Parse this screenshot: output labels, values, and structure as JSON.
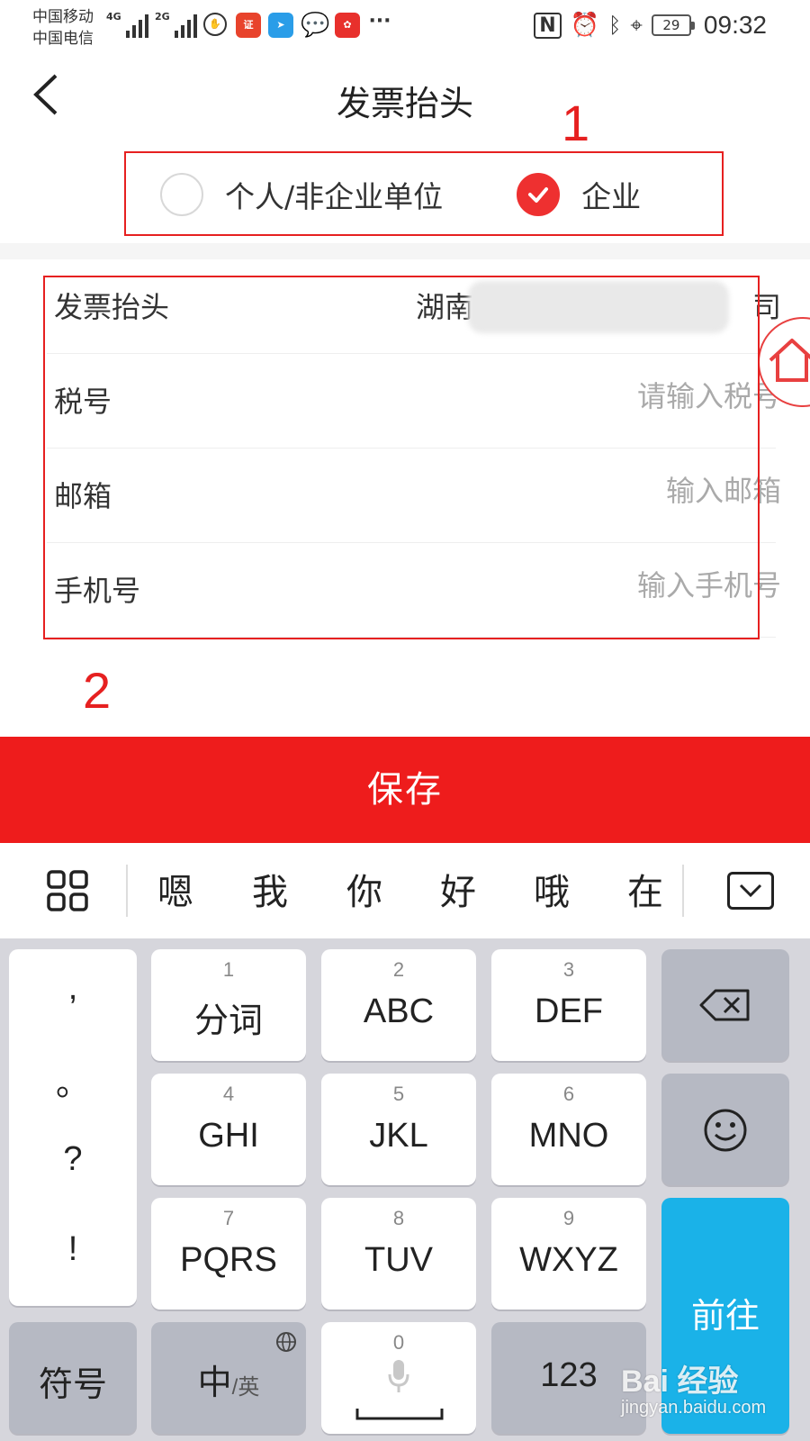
{
  "status_bar": {
    "carrier1": "中国移动",
    "carrier2": "中国电信",
    "net1": "4G",
    "net2": "2G",
    "battery": "29",
    "time": "09:32",
    "more": "···"
  },
  "nav": {
    "back_icon": "chevron-left-icon",
    "title": "发票抬头"
  },
  "annotations": {
    "num1": "1",
    "num2": "2",
    "color": "#e62020"
  },
  "invoice_type": {
    "options": [
      {
        "label": "个人/非企业单位",
        "checked": false
      },
      {
        "label": "企业",
        "checked": true
      }
    ],
    "check_color": "#ee3030"
  },
  "form": {
    "title_row": {
      "label": "发票抬头",
      "value_start": "湖南-",
      "value_end": "司"
    },
    "tax_row": {
      "label": "税号",
      "placeholder": "请输入税号"
    },
    "email_row": {
      "label": "邮箱",
      "placeholder": "输入邮箱"
    },
    "phone_row": {
      "label": "手机号",
      "placeholder": "输入手机号"
    }
  },
  "save_button": {
    "label": "保存",
    "color": "#ee1c1c"
  },
  "candidates": [
    "嗯",
    "我",
    "你",
    "好",
    "哦",
    "在"
  ],
  "keyboard": {
    "punct": [
      ",",
      "。",
      "?",
      "!"
    ],
    "keys": [
      {
        "num": "1",
        "label": "分词"
      },
      {
        "num": "2",
        "label": "ABC"
      },
      {
        "num": "3",
        "label": "DEF"
      },
      {
        "num": "4",
        "label": "GHI"
      },
      {
        "num": "5",
        "label": "JKL"
      },
      {
        "num": "6",
        "label": "MNO"
      },
      {
        "num": "7",
        "label": "PQRS"
      },
      {
        "num": "8",
        "label": "TUV"
      },
      {
        "num": "9",
        "label": "WXYZ"
      }
    ],
    "symbol": "符号",
    "lang_main": "中",
    "lang_sub": "/英",
    "space_num": "0",
    "num_key": "123",
    "go": "前往",
    "go_color": "#1ab2e8"
  },
  "watermark": {
    "text1": "Bai 经验",
    "text2": "jingyan.baidu.com"
  }
}
